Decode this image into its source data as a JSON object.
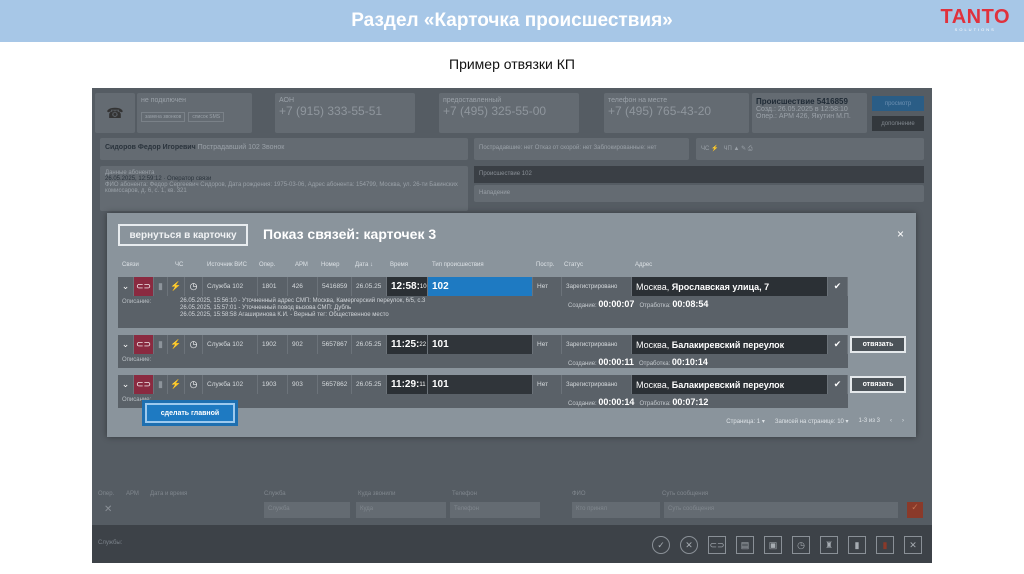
{
  "slide": {
    "title": "Раздел «Карточка происшествия»",
    "subtitle": "Пример отвязки КП",
    "logo": "TANTO",
    "logo_sub": "SOLUTIONS"
  },
  "app": {
    "line1": {
      "status": "не подключен",
      "btn1": "замена звонков",
      "btn2": "список SMS"
    },
    "phones": [
      {
        "label": "АОН",
        "number": "+7 (915) 333-55-51"
      },
      {
        "label": "предоставленный",
        "number": "+7 (495) 325-55-00",
        "tag": "АОН"
      },
      {
        "label": "телефон на месте",
        "number": "+7 (495) 765-43-20",
        "tag": "АОН"
      }
    ],
    "incident": {
      "title": "Происшествие 5416859",
      "created": "Созд.: 26.05.2025 в 12:58:10",
      "oper": "Опер.: АРМ 426, Якутин М.П.",
      "view": "просмотр",
      "extra": "дополнение"
    },
    "caller": {
      "name": "Сидоров Федор Игоревич",
      "role": "Пострадавший",
      "service": "102",
      "type": "Звонок"
    },
    "flags": "Пострадавшие: нет  Отказ от скорой: нет  Заблокированные: нет",
    "flag_chs": "ЧС",
    "flag_chp": "ЧП",
    "subscriber": {
      "h": "Данные абонента",
      "line": "26.05.2025, 12:59:12 · Оператор связи",
      "info": "ФИО абонента: Федор Сергеевич Сидоров, Дата рождения: 1975-03-06, Адрес абонента: 154799, Москва, ул. 26-ти Бакинских комиссаров, д. 6, с. 1, кв. 321"
    },
    "right_panel": {
      "incident102": "Происшествие 102",
      "attack": "Нападение"
    },
    "bottom": {
      "labels": [
        "Опер.",
        "АРМ",
        "Дата и время",
        "Служба",
        "Куда звонили",
        "Телефон",
        "ФИО",
        "Суть сообщения"
      ],
      "placeholders": [
        "Служба",
        "Куда",
        "Телефон",
        "Кто принял",
        "Суть сообщения"
      ],
      "services": "Службы:"
    }
  },
  "modal": {
    "back": "вернуться в карточку",
    "title": "Показ связей: карточек 3",
    "close": "×",
    "headers": [
      "Связи",
      "ЧС",
      "Источник ВИС",
      "Опер.",
      "АРМ",
      "Номер",
      "Дата",
      "Время",
      "Тип происшествия",
      "Постр.",
      "Статус",
      "Адрес"
    ],
    "rows": [
      {
        "source": "Служба 102",
        "oper": "1801",
        "arm": "426",
        "number": "5416859",
        "date": "26.05.25",
        "time": "12:58:",
        "sec": "10",
        "type": "102",
        "postr": "Нет",
        "status": "Зарегистрировано",
        "city": "Москва,",
        "street": " Ярославская улица, 7",
        "desc_label": "Описание:",
        "desc": [
          "26.05.2025, 15:56:10 - Уточненный адрес СМП: Москва, Камергерский переулок, 6/5, с.3",
          "26.05.2025, 15:57:01 - Уточненный повод вызова СМП: Дубль",
          "26.05.2025, 15:58:58 Агаширинова К.И. - Верный тег: Общественное место"
        ],
        "c_label": "Создание:",
        "c": "00:00:07",
        "w_label": "Отработка:",
        "w": "00:08:54"
      },
      {
        "source": "Служба 102",
        "oper": "1902",
        "arm": "902",
        "number": "5657867",
        "date": "26.05.25",
        "time": "11:25:",
        "sec": "22",
        "type": "101",
        "postr": "Нет",
        "status": "Зарегистрировано",
        "city": "Москва,",
        "street": " Балакиревский переулок",
        "desc_label": "Описание:",
        "c_label": "Создание:",
        "c": "00:00:11",
        "w_label": "Отработка:",
        "w": "00:10:14",
        "detach": "отвязать"
      },
      {
        "source": "Служба 102",
        "oper": "1903",
        "arm": "903",
        "number": "5657862",
        "date": "26.05.25",
        "time": "11:29:",
        "sec": "11",
        "type": "101",
        "postr": "Нет",
        "status": "Зарегистрировано",
        "city": "Москва,",
        "street": " Балакиревский переулок",
        "desc_label": "Описание:",
        "c_label": "Создание:",
        "c": "00:00:14",
        "w_label": "Отработка:",
        "w": "00:07:12",
        "detach": "отвязать"
      }
    ],
    "make_main": "сделать главной",
    "pagination": {
      "page": "Страница: 1 ▾",
      "per_page": "Записей на странице: 10 ▾",
      "range": "1-3 из 3",
      "prev": "‹",
      "next": "›"
    }
  }
}
